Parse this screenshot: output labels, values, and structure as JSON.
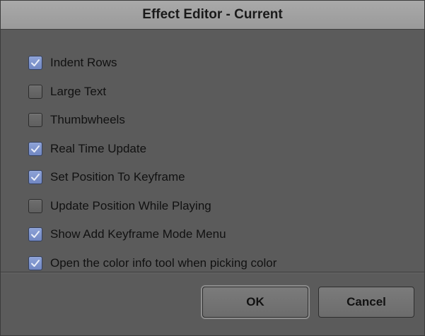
{
  "dialog": {
    "title": "Effect Editor - Current"
  },
  "options": [
    {
      "label": "Indent Rows",
      "checked": true
    },
    {
      "label": "Large Text",
      "checked": false
    },
    {
      "label": "Thumbwheels",
      "checked": false
    },
    {
      "label": "Real Time Update",
      "checked": true
    },
    {
      "label": "Set Position To Keyframe",
      "checked": true
    },
    {
      "label": "Update Position While Playing",
      "checked": false
    },
    {
      "label": "Show Add Keyframe Mode Menu",
      "checked": true
    },
    {
      "label": "Open the color info tool when picking color",
      "checked": true
    }
  ],
  "buttons": {
    "ok_label": "OK",
    "cancel_label": "Cancel"
  },
  "colors": {
    "background": "#5b5b5b",
    "titlebar": "#a0a0a0",
    "checkbox_checked": "#7f95cf"
  }
}
